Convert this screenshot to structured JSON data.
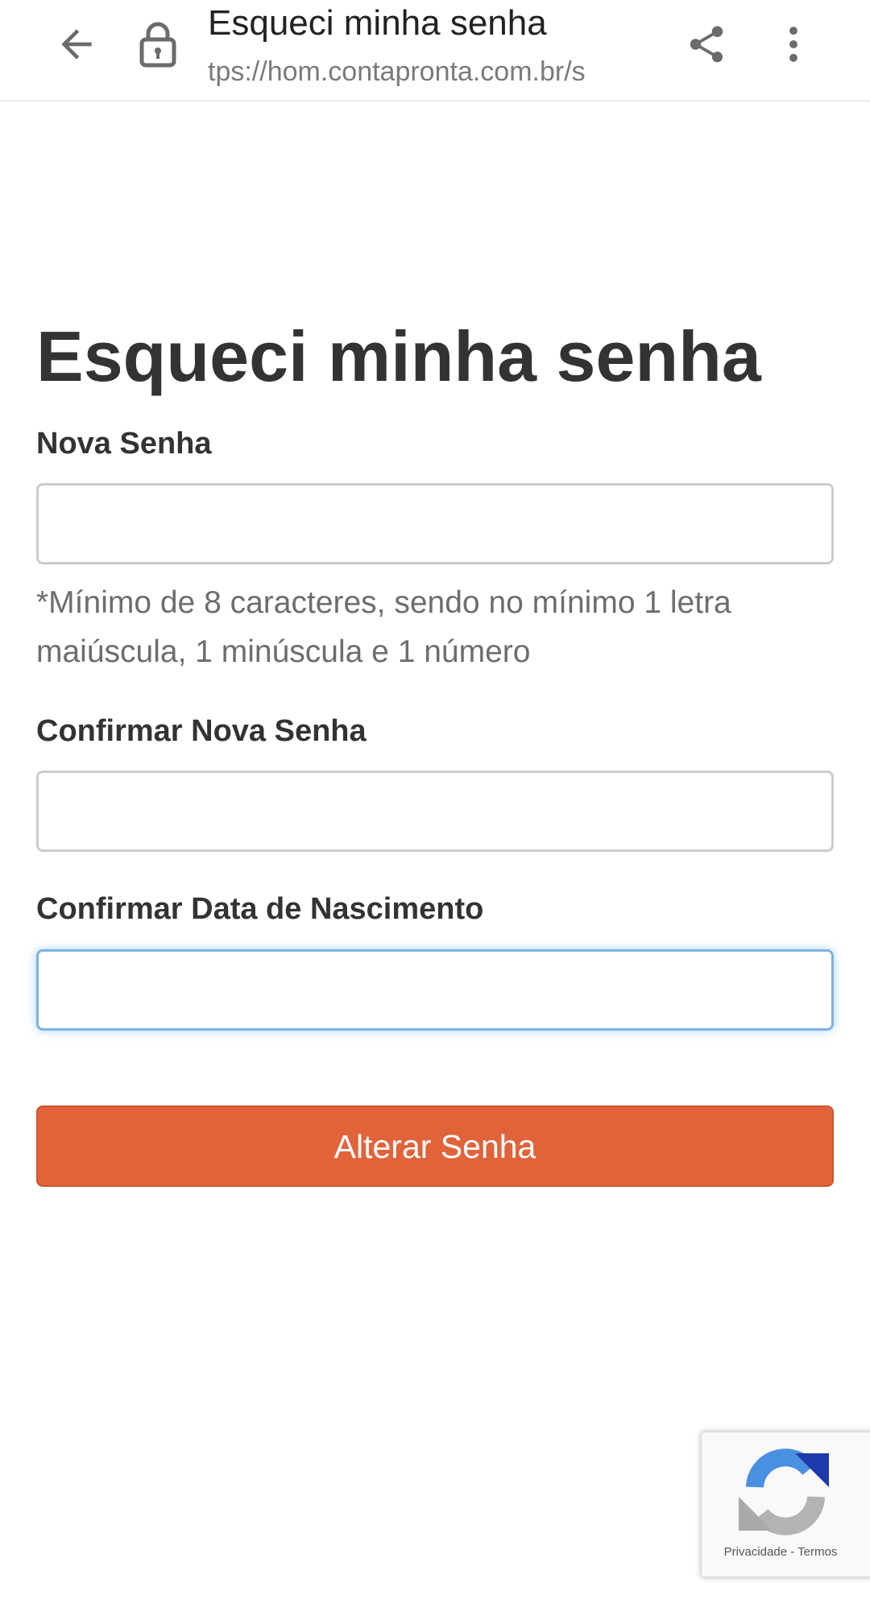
{
  "browser": {
    "tab_title": "Esqueci minha senha",
    "url": "tps://hom.contapronta.com.br/s",
    "icons": {
      "back": "arrow-left-icon",
      "lock": "lock-icon",
      "share": "share-icon",
      "menu": "more-vertical-icon"
    }
  },
  "page": {
    "title": "Esqueci minha senha"
  },
  "form": {
    "new_password": {
      "label": "Nova Senha",
      "value": "",
      "help": "*Mínimo de 8 caracteres, sendo no mínimo 1 letra maiúscula, 1 minúscula e 1 número"
    },
    "confirm_password": {
      "label": "Confirmar Nova Senha",
      "value": ""
    },
    "birth_date": {
      "label": "Confirmar Data de Nascimento",
      "value": "",
      "focused": true
    },
    "submit_label": "Alterar Senha"
  },
  "recaptcha": {
    "privacy_label": "Privacidade",
    "separator": " - ",
    "terms_label": "Termos"
  },
  "colors": {
    "accent_button": "#e0633a",
    "focus_border": "#7fb2df",
    "text": "#333333",
    "muted_text": "#6d6d6d"
  }
}
